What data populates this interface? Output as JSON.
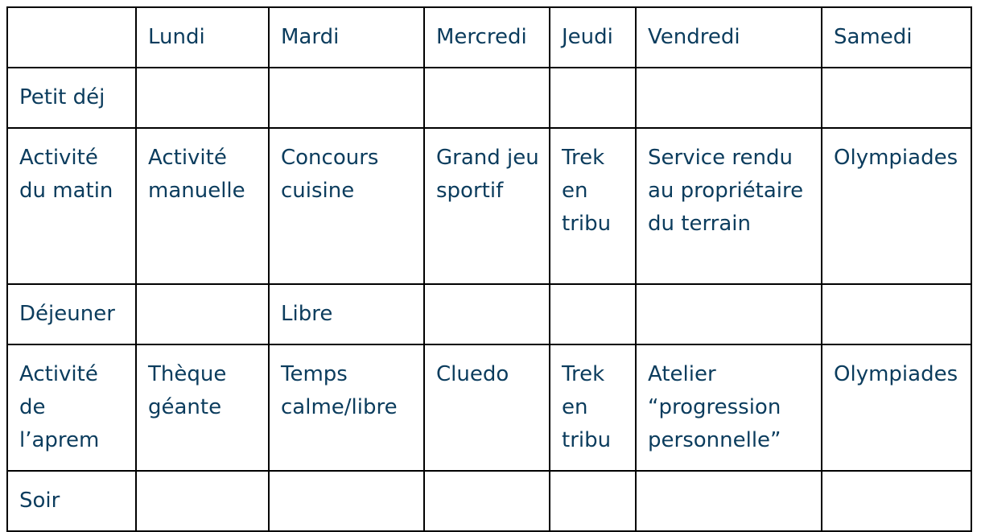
{
  "table": {
    "columns": [
      "",
      "Lundi",
      "Mardi",
      "Mercredi",
      "Jeudi",
      "Vendredi",
      "Samedi"
    ],
    "rows": [
      {
        "label": "Petit déj",
        "cells": [
          "",
          "",
          "",
          "",
          "",
          ""
        ]
      },
      {
        "label": "Activité du matin",
        "cells": [
          "Activité manuelle",
          "Concours cuisine",
          "Grand jeu sportif",
          "Trek en tribu",
          "Service rendu au propriétaire du terrain",
          "Olympiades"
        ]
      },
      {
        "label": "Déjeuner",
        "cells": [
          "",
          "Libre",
          "",
          "",
          "",
          ""
        ]
      },
      {
        "label": "Activité de l’aprem",
        "cells": [
          "Thèque géante",
          "Temps calme/libre",
          "Cluedo",
          "Trek en tribu",
          "Atelier “progression personnelle”",
          "Olympiades"
        ]
      },
      {
        "label": "Soir",
        "cells": [
          "",
          "",
          "",
          "",
          "",
          ""
        ]
      }
    ]
  }
}
